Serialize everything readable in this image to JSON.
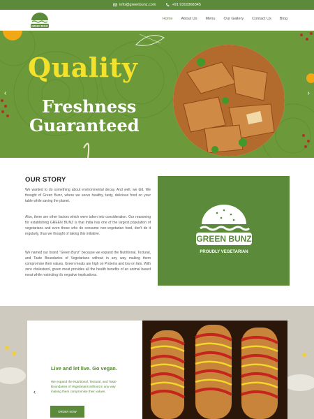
{
  "topbar": {
    "email": "info@greenbunz.com",
    "phone": "+91 9310368345"
  },
  "header": {
    "logo_text": "GREEN BUNZ",
    "nav": [
      "Home",
      "About Us",
      "Menu",
      "Our Gallery",
      "Contact Us",
      "Blog"
    ],
    "active_index": 0
  },
  "hero": {
    "line1": "Quality",
    "line2": "Freshness",
    "line3": "Guaranteed",
    "prev_icon": "‹",
    "next_icon": "›"
  },
  "story": {
    "title": "OUR STORY",
    "p1": "We wanted to do something about environmental decay. And well, we did. We thought of Green Bunz, where we serve healthy, tasty, delicious food on your table while saving the planet.",
    "p2": "Also, there are other factors which were taken into consideration. Our reasoning for establishing GREEN BUNZ is that India has one of the largest population of vegetarians and even those who do consume non-vegetarian food, don't do it regularly, thus we thought of taking this initiative.",
    "p3": "We named our brand \"Green Bunz\" because we expand the Nutritional, Textural, and Taste Boundaries of Vegetarians without in any way making them compromise their values. Green meats are high on Proteins and low on fats. With zero cholesterol, green meat provides all the health benefits of an animal based meat while restricting it's negative implications.",
    "badge_title": "GREEN BUNZ",
    "badge_sub": "PROUDLY VEGETARIAN"
  },
  "promo": {
    "heading": "Live and let live. Go vegan.",
    "text": "We expand the Nutritional, Textural, and Taste Boundaries of Vegetarians without in any way making them compromise their values.",
    "button": "ORDER NOW",
    "chevron": "‹"
  },
  "colors": {
    "green": "#5b8a3a",
    "hero_green": "#6c9a3a",
    "yellow": "#f3e12b"
  }
}
